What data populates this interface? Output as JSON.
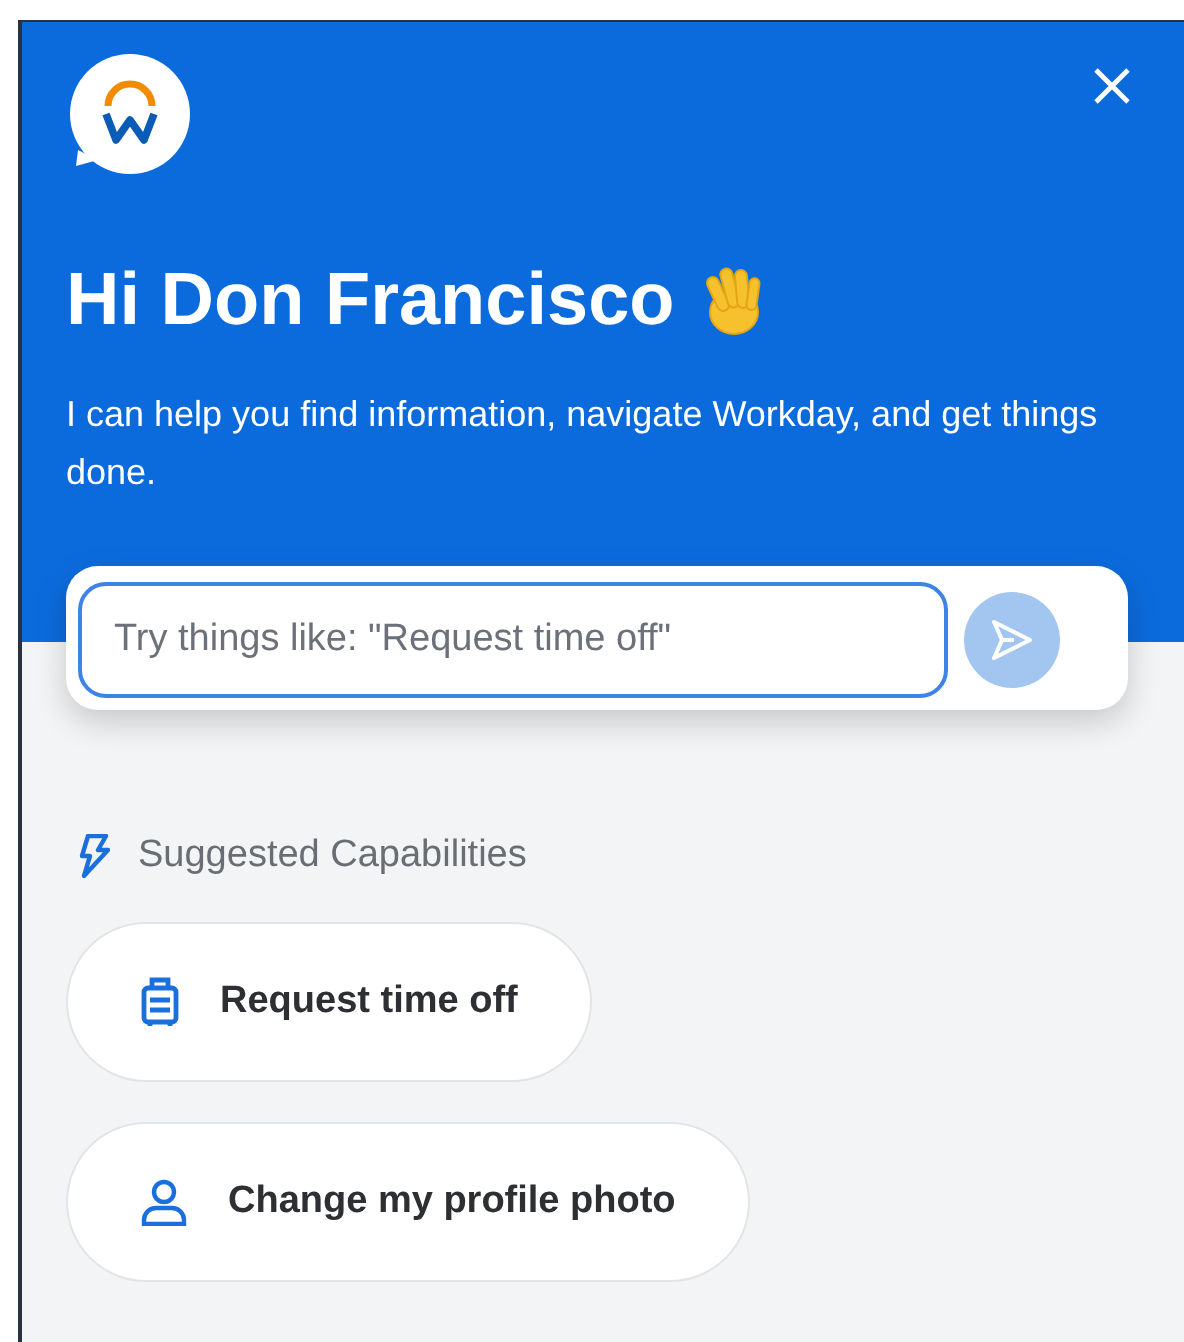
{
  "header": {
    "title": "Hi Don Francisco",
    "subtitle": "I can help you find information, navigate Workday, and get things done."
  },
  "prompt": {
    "placeholder": "Try things like: \"Request time off\"",
    "send_disabled": true
  },
  "suggestions": {
    "heading": "Suggested Capabilities",
    "items": [
      {
        "label": "Request time off",
        "kind": "luggage"
      },
      {
        "label": "Change my profile photo",
        "kind": "person"
      }
    ]
  }
}
